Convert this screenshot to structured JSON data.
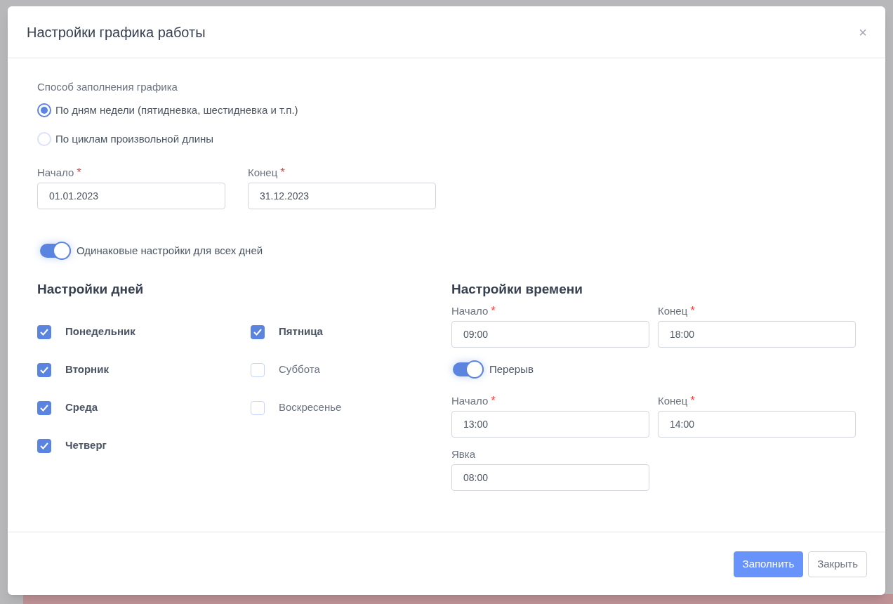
{
  "dialog": {
    "title": "Настройки графика работы",
    "close_label": "×"
  },
  "fill_method": {
    "label": "Способ заполнения графика",
    "options": [
      {
        "label": "По дням недели (пятидневка, шестидневка и т.п.)",
        "selected": true
      },
      {
        "label": "По циклам произвольной длины",
        "selected": false
      }
    ]
  },
  "period": [
    {
      "label": "Начало",
      "required_mark": "*",
      "value": "01.01.2023"
    },
    {
      "label": "Конец",
      "required_mark": "*",
      "value": "31.12.2023"
    }
  ],
  "same_settings": {
    "label": "Одинаковые настройки для всех дней",
    "on": true
  },
  "days": {
    "title": "Настройки дней",
    "items": [
      {
        "label": "Понедельник",
        "checked": true
      },
      {
        "label": "Вторник",
        "checked": true
      },
      {
        "label": "Среда",
        "checked": true
      },
      {
        "label": "Четверг",
        "checked": true
      },
      {
        "label": "Пятница",
        "checked": true
      },
      {
        "label": "Суббота",
        "checked": false
      },
      {
        "label": "Воскресенье",
        "checked": false
      }
    ]
  },
  "time": {
    "title": "Настройки времени",
    "work": [
      {
        "label": "Начало",
        "required_mark": "*",
        "value": "09:00"
      },
      {
        "label": "Конец",
        "required_mark": "*",
        "value": "18:00"
      }
    ],
    "break_toggle": {
      "label": "Перерыв",
      "on": true
    },
    "break": [
      {
        "label": "Начало",
        "required_mark": "*",
        "value": "13:00"
      },
      {
        "label": "Конец",
        "required_mark": "*",
        "value": "14:00"
      }
    ],
    "arrival": {
      "label": "Явка",
      "value": "08:00"
    }
  },
  "buttons": [
    {
      "label": "Заполнить",
      "kind": "primary"
    },
    {
      "label": "Закрыть",
      "kind": "secondary"
    }
  ]
}
